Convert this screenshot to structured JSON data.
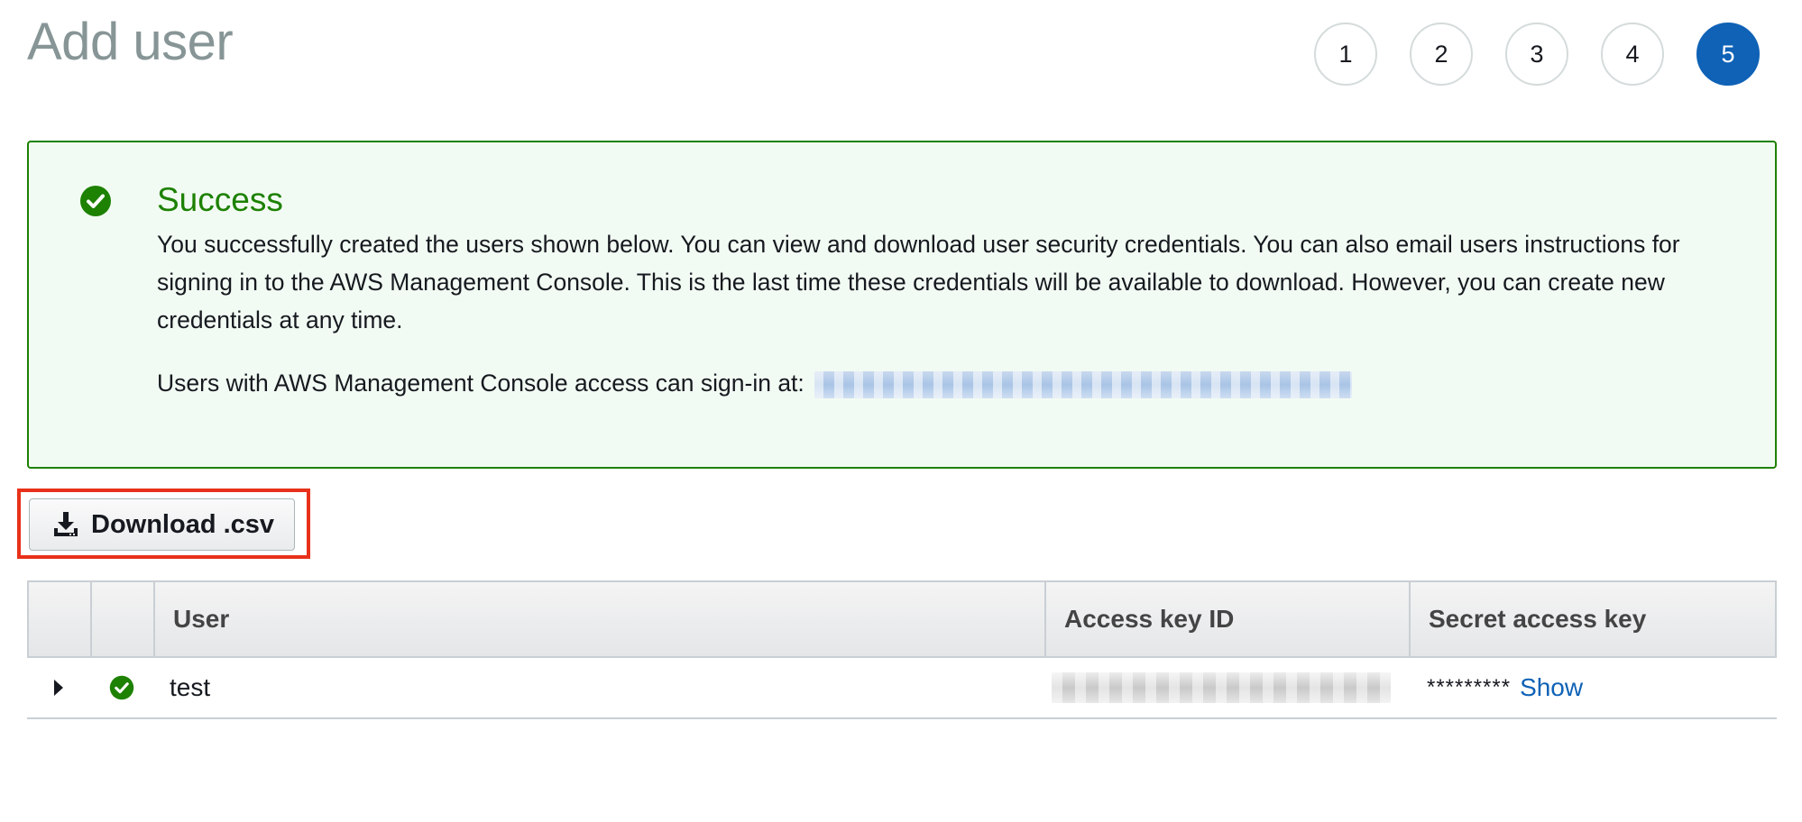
{
  "page": {
    "title": "Add user"
  },
  "steps": [
    "1",
    "2",
    "3",
    "4",
    "5"
  ],
  "active_step": "5",
  "alert": {
    "title": "Success",
    "body": "You successfully created the users shown below. You can view and download user security credentials. You can also email users instructions for signing in to the AWS Management Console. This is the last time these credentials will be available to download. However, you can create new credentials at any time.",
    "signin_text": "Users with AWS Management Console access can sign-in at:",
    "icon": "check-circle-icon"
  },
  "toolbar": {
    "download_label": "Download .csv",
    "download_icon": "download-icon"
  },
  "table": {
    "columns": [
      "User",
      "Access key ID",
      "Secret access key"
    ],
    "rows": [
      {
        "user": "test",
        "status_icon": "check-circle-icon",
        "secret_masked": "*********",
        "show_label": "Show"
      }
    ]
  },
  "colors": {
    "success": "#1d8102",
    "success_bg": "#f2fbf3",
    "active_step": "#0f62b6",
    "link": "#0f62b6",
    "highlight_frame": "#e8311a"
  }
}
